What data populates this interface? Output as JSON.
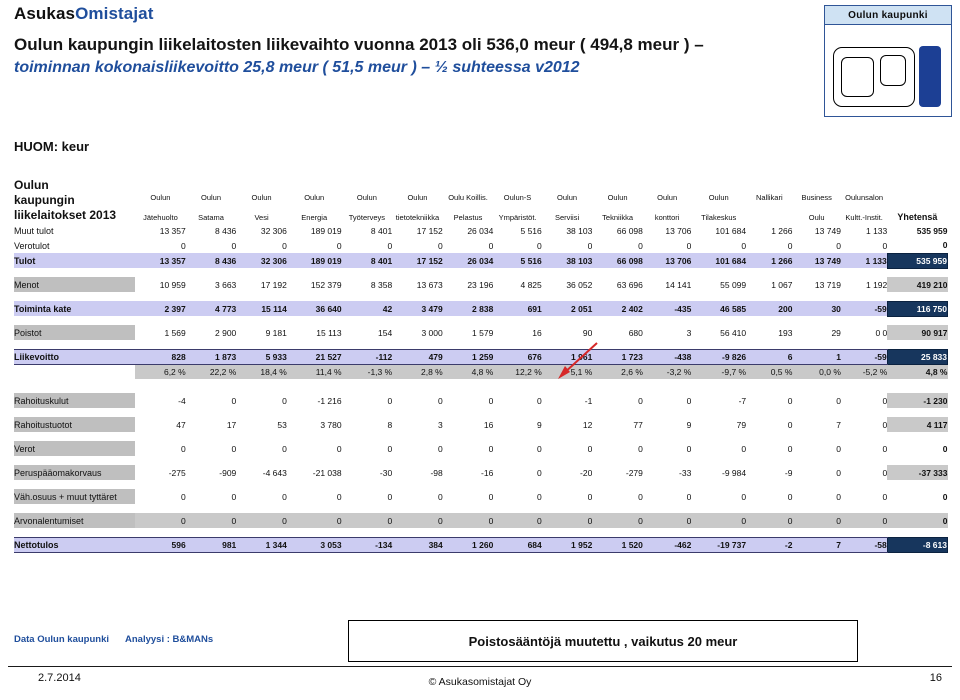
{
  "brand": {
    "part1": "Asukas",
    "part2": "Omistajat"
  },
  "title": {
    "line1": "Oulun kaupungin liikelaitosten liikevaihto vuonna 2013 oli 536,0 meur ( 494,8 meur ) –",
    "line2": "toiminnan kokonaisliikevoitto 25,8 meur ( 51,5  meur ) – ½ suhteessa v2012"
  },
  "logo": {
    "caption": "Oulun kaupunki"
  },
  "unit_note": "HUOM: keur",
  "table": {
    "section_title_lines": [
      "Oulun",
      "kaupungin",
      "liikelaitokset 2013"
    ],
    "columns": [
      {
        "top": "Oulun",
        "bottom": "Jätehuolto"
      },
      {
        "top": "Oulun",
        "bottom": "Satama"
      },
      {
        "top": "Oulun",
        "bottom": "Vesi"
      },
      {
        "top": "Oulun",
        "bottom": "Energia"
      },
      {
        "top": "Oulun",
        "bottom": "Työterveys"
      },
      {
        "top": "Oulun",
        "bottom": "tietotekniikka"
      },
      {
        "top": "Oulu Koillis.",
        "bottom": "Pelastus"
      },
      {
        "top": "Oulun-S",
        "bottom": "Ympäristöt."
      },
      {
        "top": "Oulun",
        "bottom": "Serviisi"
      },
      {
        "top": "Oulun",
        "bottom": "Tekniikka"
      },
      {
        "top": "Oulun",
        "bottom": "konttori"
      },
      {
        "top": "Oulun",
        "bottom": "Tilakeskus"
      },
      {
        "top": "Nallikari",
        "bottom": ""
      },
      {
        "top": "Business",
        "bottom": "Oulu"
      },
      {
        "top": "Oulunsalon",
        "bottom": "Kultt.-Instit."
      }
    ],
    "total_column": "Yhetensä",
    "rows": [
      {
        "label": "Muut tulot",
        "style": "plain",
        "values": [
          "13 357",
          "8 436",
          "32 306",
          "189 019",
          "8 401",
          "17 152",
          "26 034",
          "5 516",
          "38 103",
          "66 098",
          "13 706",
          "101 684",
          "1 266",
          "13 749",
          "1 133"
        ],
        "total": "535 959"
      },
      {
        "label": "Verotulot",
        "style": "plain",
        "values": [
          "0",
          "0",
          "0",
          "0",
          "0",
          "0",
          "0",
          "0",
          "0",
          "0",
          "0",
          "0",
          "0",
          "0",
          "0"
        ],
        "total": "0"
      },
      {
        "label": "Tulot",
        "style": "lavender-bold",
        "values": [
          "13 357",
          "8 436",
          "32 306",
          "189 019",
          "8 401",
          "17 152",
          "26 034",
          "5 516",
          "38 103",
          "66 098",
          "13 706",
          "101 684",
          "1 266",
          "13 749",
          "1 133"
        ],
        "total": "535 959"
      },
      {
        "label": "Menot",
        "style": "gray-bold",
        "values": [
          "10 959",
          "3 663",
          "17 192",
          "152 379",
          "8 358",
          "13 673",
          "23 196",
          "4 825",
          "36 052",
          "63 696",
          "14 141",
          "55 099",
          "1 067",
          "13 719",
          "1 192"
        ],
        "total": "419 210"
      },
      {
        "label": "Toiminta kate",
        "style": "lavender-bold",
        "values": [
          "2 397",
          "4 773",
          "15 114",
          "36 640",
          "42",
          "3 479",
          "2 838",
          "691",
          "2 051",
          "2 402",
          "-435",
          "46 585",
          "200",
          "30",
          "-59"
        ],
        "total": "116 750"
      },
      {
        "label": "Poistot",
        "style": "gray-bold",
        "values": [
          "1 569",
          "2 900",
          "9 181",
          "15 113",
          "154",
          "3 000",
          "1 579",
          "16",
          "90",
          "680",
          "3",
          "56 410",
          "193",
          "29",
          "0"
        ],
        "total": "90 917",
        "extra_zero": "0"
      },
      {
        "label": "Liikevoitto",
        "style": "lavender-bold-border",
        "values": [
          "828",
          "1 873",
          "5 933",
          "21 527",
          "-112",
          "479",
          "1 259",
          "676",
          "1 961",
          "1 723",
          "-438",
          "-9 826",
          "6",
          "1",
          "-59"
        ],
        "total": "25 833"
      },
      {
        "label": "",
        "style": "gray-pct",
        "values": [
          "6,2 %",
          "22,2 %",
          "18,4 %",
          "11,4 %",
          "-1,3 %",
          "2,8 %",
          "4,8 %",
          "12,2 %",
          "5,1 %",
          "2,6 %",
          "-3,2 %",
          "-9,7 %",
          "0,5 %",
          "0,0 %",
          "-5,2 %"
        ],
        "total": "4,8 %"
      },
      {
        "label": "Rahoituskulut",
        "style": "gray-bold",
        "values": [
          "-4",
          "0",
          "0",
          "-1 216",
          "0",
          "0",
          "0",
          "0",
          "-1",
          "0",
          "0",
          "-7",
          "0",
          "0",
          "0"
        ],
        "total": "-1 230"
      },
      {
        "label": "Rahoitustuotot",
        "style": "gray-bold",
        "values": [
          "47",
          "17",
          "53",
          "3 780",
          "8",
          "3",
          "16",
          "9",
          "12",
          "77",
          "9",
          "79",
          "0",
          "7",
          "0"
        ],
        "total": "4 117"
      },
      {
        "label": "Verot",
        "style": "gray-label-only",
        "values": [
          "0",
          "0",
          "0",
          "0",
          "0",
          "0",
          "0",
          "0",
          "0",
          "0",
          "0",
          "0",
          "0",
          "0",
          "0"
        ],
        "total": "0"
      },
      {
        "label": "Peruspääomakorvaus",
        "style": "gray-bold",
        "values": [
          "-275",
          "-909",
          "-4 643",
          "-21 038",
          "-30",
          "-98",
          "-16",
          "0",
          "-20",
          "-279",
          "-33",
          "-9 984",
          "-9",
          "0",
          "0"
        ],
        "total": "-37 333"
      },
      {
        "label": "Väh.osuus + muut tyttäret",
        "style": "gray-label-only",
        "values": [
          "0",
          "0",
          "0",
          "0",
          "0",
          "0",
          "0",
          "0",
          "0",
          "0",
          "0",
          "0",
          "0",
          "0",
          "0"
        ],
        "total": "0"
      },
      {
        "label": "Arvonalentumiset",
        "style": "gray-full",
        "values": [
          "0",
          "0",
          "0",
          "0",
          "0",
          "0",
          "0",
          "0",
          "0",
          "0",
          "0",
          "0",
          "0",
          "0",
          "0"
        ],
        "total": "0"
      },
      {
        "label": "Nettotulos",
        "style": "lavender-bold-border",
        "values": [
          "596",
          "981",
          "1 344",
          "3 053",
          "-134",
          "384",
          "1 260",
          "684",
          "1 952",
          "1 520",
          "-462",
          "-19 737",
          "-2",
          "7",
          "-58"
        ],
        "total": "-8 613"
      }
    ]
  },
  "annotation": {
    "arrow_target": "56 410",
    "arrow_color": "#d62828"
  },
  "footer": {
    "source_data": "Data Oulun kaupunki",
    "source_analysis": "Analyysi : B&MANs",
    "note": "Poistosääntöjä muutettu , vaikutus 20 meur",
    "date": "2.7.2014",
    "copyright": "© Asukasomistajat Oy",
    "page_number": "16"
  }
}
